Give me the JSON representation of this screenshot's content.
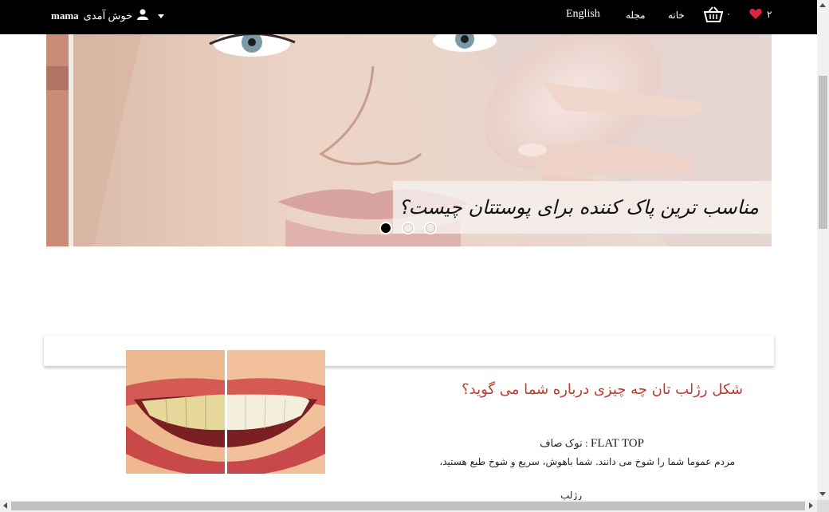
{
  "nav": {
    "welcome_text": "خوش آمدی",
    "username": "mama",
    "english_label": "English",
    "magazine_label": "مجله",
    "home_label": "خانه",
    "cart_count": "۰",
    "favorites_count": "۲"
  },
  "hero": {
    "caption": "مناسب ترین پاک کننده برای پوستتان چیست؟",
    "slides": 3,
    "active_slide": 1
  },
  "article": {
    "title": "شکل رژلب تان چه چیزی درباره شما می گوید؟",
    "flat_top_en": "FLAT TOP",
    "flat_top_fa": ": نوک صاف",
    "description": "مردم عموما شما را شوخ می دانند. شما باهوش، سریع و شوخ طبع هستید،",
    "next_heading": "رژلب"
  },
  "colors": {
    "navbar": "#000000",
    "accent_title": "#c0392b",
    "heart": "#e0223a"
  },
  "icons": [
    "user-icon",
    "basket-icon",
    "heart-icon"
  ]
}
